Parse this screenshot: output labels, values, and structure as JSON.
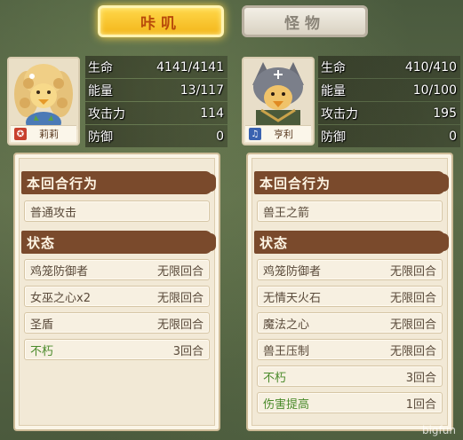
{
  "tabs": [
    {
      "label": "咔叽",
      "active": true
    },
    {
      "label": "怪物",
      "active": false
    }
  ],
  "left": {
    "name": "莉莉",
    "badge_color": "#c8412e",
    "stats": [
      {
        "label": "生命",
        "value": "4141/4141"
      },
      {
        "label": "能量",
        "value": "13/117"
      },
      {
        "label": "攻击力",
        "value": "114"
      },
      {
        "label": "防御",
        "value": "0"
      }
    ],
    "action_header": "本回合行为",
    "action": "普通攻击",
    "status_header": "状态",
    "statuses": [
      {
        "name": "鸡笼防御者",
        "duration": "无限回合",
        "positive": false
      },
      {
        "name": "女巫之心x2",
        "duration": "无限回合",
        "positive": false
      },
      {
        "name": "圣盾",
        "duration": "无限回合",
        "positive": false
      },
      {
        "name": "不朽",
        "duration": "3回合",
        "positive": true
      }
    ]
  },
  "right": {
    "name": "亨利",
    "badge_color": "#3a62b0",
    "stats": [
      {
        "label": "生命",
        "value": "410/410"
      },
      {
        "label": "能量",
        "value": "10/100"
      },
      {
        "label": "攻击力",
        "value": "195"
      },
      {
        "label": "防御",
        "value": "0"
      }
    ],
    "action_header": "本回合行为",
    "action": "兽王之箭",
    "status_header": "状态",
    "statuses": [
      {
        "name": "鸡笼防御者",
        "duration": "无限回合",
        "positive": false
      },
      {
        "name": "无情天火石",
        "duration": "无限回合",
        "positive": false
      },
      {
        "name": "魔法之心",
        "duration": "无限回合",
        "positive": false
      },
      {
        "name": "兽王压制",
        "duration": "无限回合",
        "positive": false
      },
      {
        "name": "不朽",
        "duration": "3回合",
        "positive": true
      },
      {
        "name": "伤害提高",
        "duration": "1回合",
        "positive": true
      }
    ]
  },
  "watermark": "bigfun"
}
